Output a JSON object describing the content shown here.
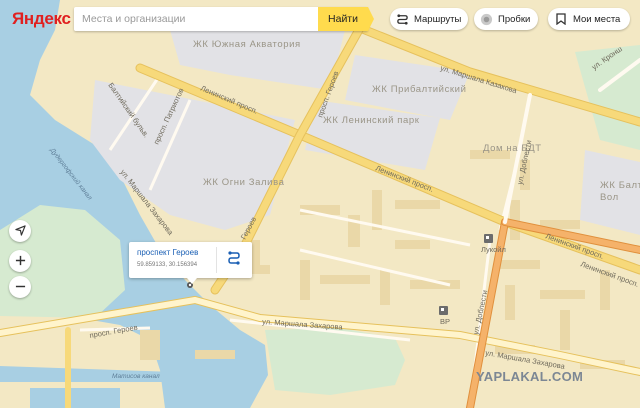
{
  "header": {
    "logo": "Яндекс",
    "search_placeholder": "Места и организации",
    "search_button": "Найти",
    "routes_label": "Маршруты",
    "traffic_label": "Пробки",
    "my_places_label": "Мои места"
  },
  "map": {
    "districts": [
      "ЖК Южная Акватория",
      "ЖК Прибалтийский",
      "ЖК Ленинский парк",
      "Дом на БДТ",
      "ЖК Огни Залива",
      "ЖК Балти",
      "Вол"
    ],
    "streets": [
      "ул. Маршала Казакова",
      "Ленинский просп.",
      "Ленинский просп.",
      "Ленинский просп.",
      "Ленинский просп.",
      "Балтийский бульв.",
      "просп. Патриотов",
      "просп. Героев",
      "ул. Маршала Захарова",
      "Героев",
      "ул. Доблести",
      "ул. Доблести",
      "ул. Маршала Захарова",
      "ул. Маршала Захарова",
      "просп. Героев",
      "ул. Кронш"
    ],
    "water_labels": [
      "Дудергофский канал",
      "Матисов канал"
    ],
    "pois": [
      "Лукойл",
      "BP"
    ]
  },
  "popup": {
    "title": "проспект Героев",
    "coords": "59.859133, 30.156394"
  },
  "watermark": "YAPLAKAL.COM",
  "colors": {
    "land": "#f3e8c4",
    "water": "#a8cfe3",
    "block": "#e2e2e6",
    "green": "#d6ead0",
    "highway": "#f7d97a",
    "trunk": "#f5b26a",
    "accent": "#ffdb4d"
  }
}
